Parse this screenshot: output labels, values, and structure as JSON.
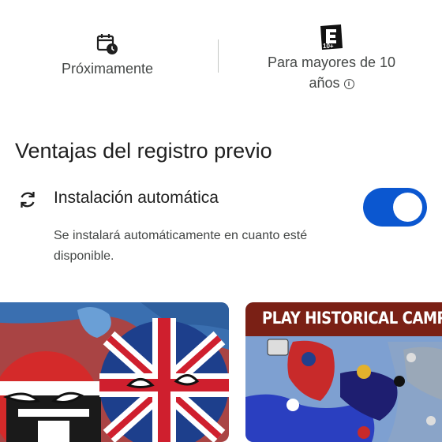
{
  "stats": {
    "release": {
      "icon": "calendar-clock-icon",
      "label": "Próximamente"
    },
    "rating": {
      "icon": "rating-e10-icon",
      "badge": "10+",
      "label_line1": "Para mayores de 10",
      "label_line2": "años",
      "info_icon": "info-icon"
    }
  },
  "preregister": {
    "title": "Ventajas del registro previo",
    "auto_install": {
      "icon": "sync-icon",
      "title": "Instalación automática",
      "description": "Se instalará automáticamente en cuanto esté disponible.",
      "toggle_on": true
    }
  },
  "screenshots": [
    {
      "name": "countryballs-screenshot"
    },
    {
      "name": "campaign-map-screenshot",
      "banner": "PLAY HISTORICAL CAMPA"
    }
  ],
  "colors": {
    "accent": "#0b57d0",
    "text": "#1f1f1f",
    "secondary_text": "#444746",
    "banner": "#7a2015"
  }
}
